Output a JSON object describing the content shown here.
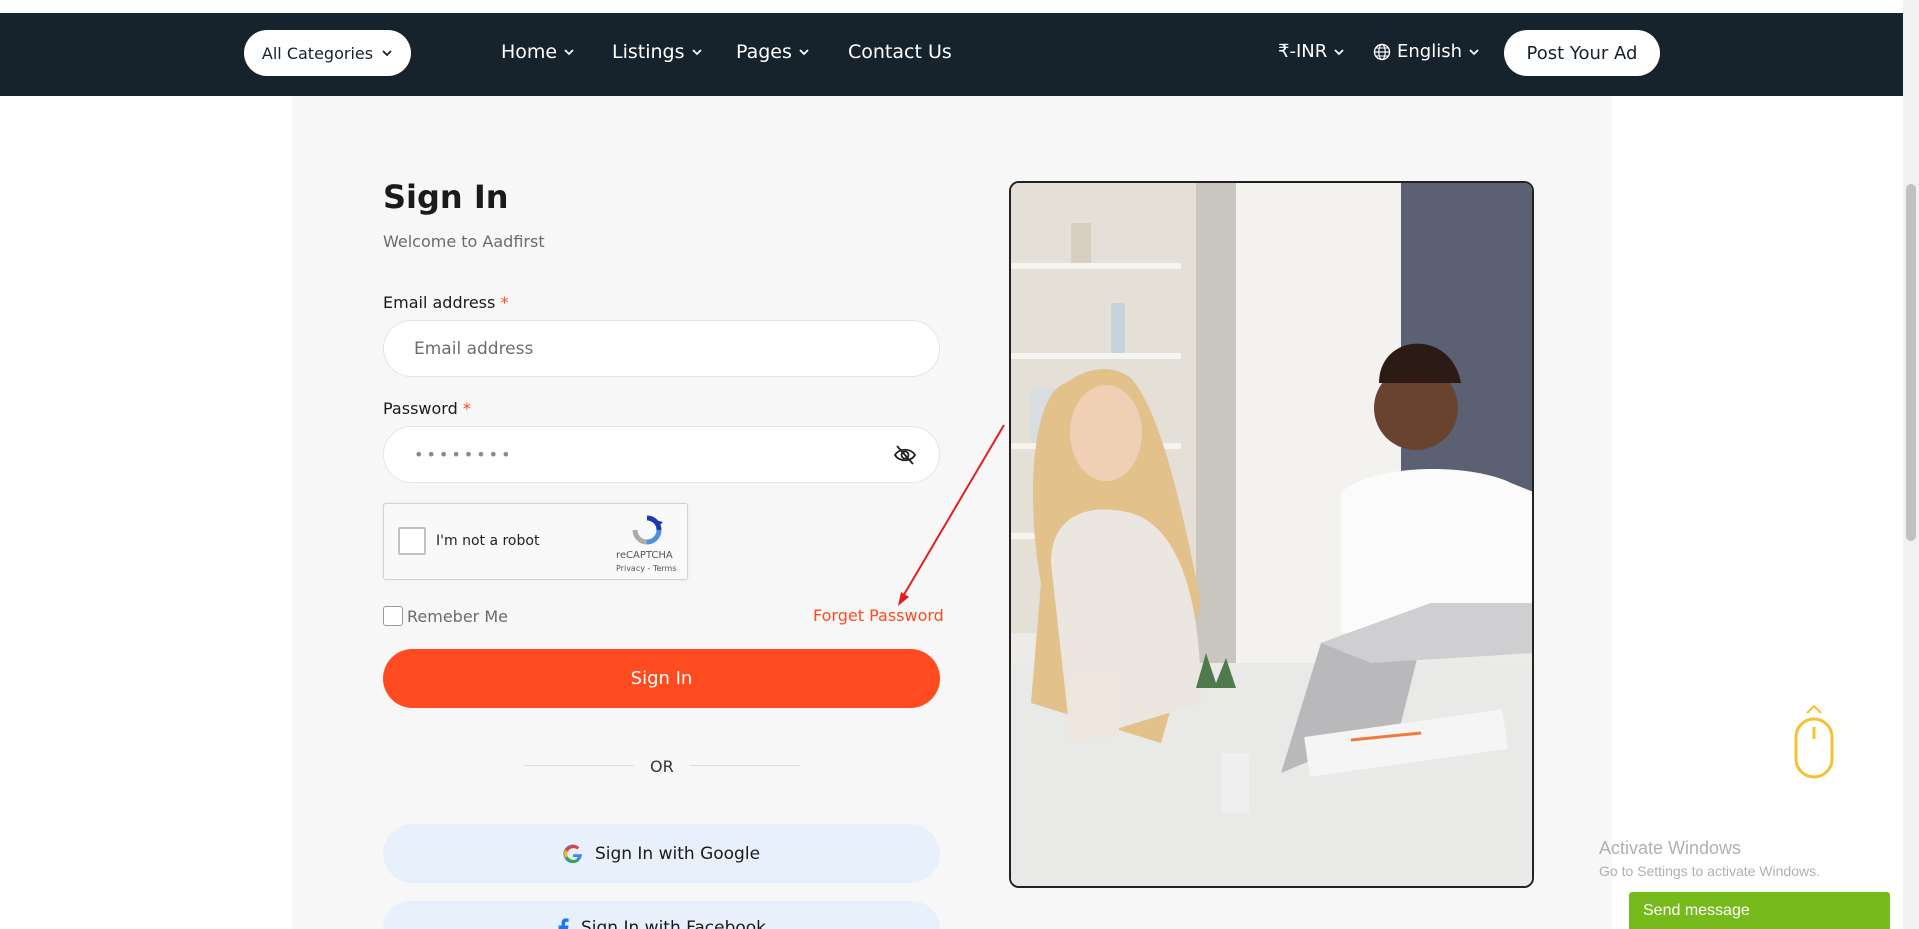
{
  "navbar": {
    "all_categories": "All Categories",
    "items": [
      {
        "label": "Home"
      },
      {
        "label": "Listings"
      },
      {
        "label": "Pages"
      },
      {
        "label": "Contact Us"
      }
    ],
    "currency": "₹-INR",
    "language": "English",
    "post_ad": "Post Your Ad",
    "bg_color": "#16222c"
  },
  "signin": {
    "title": "Sign In",
    "subtitle": "Welcome to Aadfirst",
    "email_label": "Email address",
    "email_placeholder": "Email address",
    "password_label": "Password",
    "password_value": "••••••••",
    "required_mark": "*",
    "recaptcha": {
      "label": "I'm not a robot",
      "brand": "reCAPTCHA",
      "links": "Privacy - Terms"
    },
    "remember_label": "Remeber Me",
    "forget_label": "Forget Password",
    "submit_label": "Sign In",
    "divider_label": "OR",
    "google_label": "Sign In with Google",
    "facebook_label": "Sign In with Facebook",
    "accent_color": "#ff4b1f"
  },
  "windows": {
    "activate_title": "Activate Windows",
    "activate_sub": "Go to Settings to activate Windows."
  },
  "chat": {
    "send_message": "Send message",
    "color": "#76ba1b"
  }
}
